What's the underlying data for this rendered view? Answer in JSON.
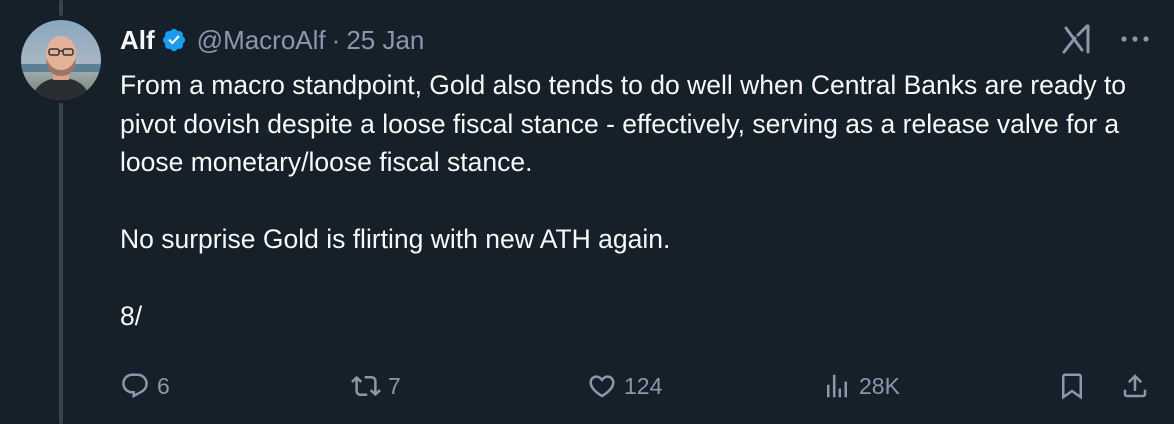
{
  "tweet": {
    "author_name": "Alf",
    "handle": "@MacroAlf",
    "separator": "·",
    "date": "25 Jan",
    "text": "From a macro standpoint, Gold also tends to do well when Central Banks are ready to pivot dovish despite a loose fiscal stance - effectively, serving as a release valve for a loose monetary/loose fiscal stance.\n\nNo surprise Gold is flirting with new ATH again.\n\n8/"
  },
  "actions": {
    "replies": "6",
    "reposts": "7",
    "likes": "124",
    "views": "28K"
  },
  "icons": {
    "verified": "verified-badge-icon",
    "grok": "grok-icon",
    "more": "more-icon",
    "reply": "reply-icon",
    "repost": "repost-icon",
    "like": "heart-icon",
    "views": "views-icon",
    "bookmark": "bookmark-icon",
    "share": "share-icon"
  },
  "colors": {
    "background": "#15202b",
    "text": "#f7f9f9",
    "secondary": "#8b98a5",
    "verified": "#1d9bf0"
  }
}
